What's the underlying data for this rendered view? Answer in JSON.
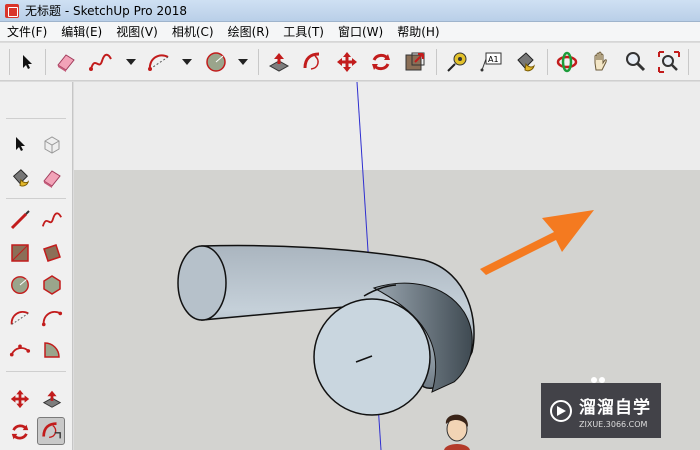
{
  "window": {
    "title": "无标题 - SketchUp Pro 2018"
  },
  "menu": [
    "文件(F)",
    "编辑(E)",
    "视图(V)",
    "相机(C)",
    "绘图(R)",
    "工具(T)",
    "窗口(W)",
    "帮助(H)"
  ],
  "toolbar_icons": [
    "select-icon",
    "eraser-icon",
    "freehand-icon",
    "arc-icon",
    "circle-icon",
    "push-pull-icon",
    "follow-me-icon",
    "move-icon",
    "rotate-icon",
    "scale-icon",
    "tape-measure-icon",
    "text-icon",
    "paint-bucket-icon",
    "orbit-icon",
    "pan-icon",
    "zoom-icon",
    "zoom-extents-icon"
  ],
  "left_tool_icons": [
    "select-icon",
    "make-component-icon",
    "paint-bucket-icon",
    "eraser-icon",
    "line-icon",
    "freehand-icon",
    "rectangle-icon",
    "rotated-rectangle-icon",
    "circle-icon",
    "polygon-icon",
    "arc-icon",
    "two-point-arc-icon",
    "three-point-arc-icon",
    "pie-icon",
    "move-icon",
    "push-pull-icon",
    "rotate-icon",
    "follow-me-icon"
  ],
  "watermark": {
    "logo_text": "溜溜自学",
    "url": "ZIXUE.3066.COM"
  },
  "colors": {
    "sky": "#ececec",
    "ground": "#d3d3d0",
    "accent_arrow": "#f47a20",
    "axis_blue": "#2f2fd0"
  }
}
